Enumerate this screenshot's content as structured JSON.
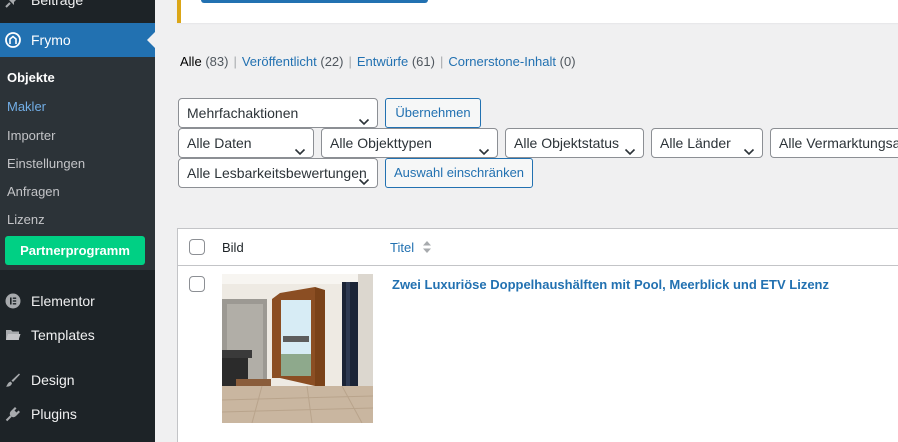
{
  "sidebar": {
    "prev_item_label": "Beiträge",
    "active_menu": {
      "label": "Frymo",
      "icon": "frymo-logo-icon"
    },
    "submenu": [
      {
        "label": "Objekte",
        "state": "current"
      },
      {
        "label": "Makler",
        "state": "hover"
      },
      {
        "label": "Importer",
        "state": ""
      },
      {
        "label": "Einstellungen",
        "state": ""
      },
      {
        "label": "Anfragen",
        "state": ""
      },
      {
        "label": "Lizenz",
        "state": ""
      }
    ],
    "partner_button": "Partnerprogramm",
    "menu": [
      {
        "label": "Elementor",
        "icon": "elementor-icon"
      },
      {
        "label": "Templates",
        "icon": "folder-icon"
      },
      {
        "label": "Design",
        "icon": "paintbrush-icon"
      },
      {
        "label": "Plugins",
        "icon": "plugin-icon"
      }
    ]
  },
  "views": {
    "all": {
      "label": "Alle",
      "count": "(83)"
    },
    "published": {
      "label": "Veröffentlicht",
      "count": "(22)"
    },
    "drafts": {
      "label": "Entwürfe",
      "count": "(61)"
    },
    "cornerstone": {
      "label": "Cornerstone-Inhalt",
      "count": "(0)"
    }
  },
  "bulk": {
    "selected": "Mehrfachaktionen",
    "apply_label": "Übernehmen"
  },
  "filters": {
    "dates": "Alle Daten",
    "types": "Alle Objekttypen",
    "status": "Alle Objektstatus",
    "countries": "Alle Länder",
    "marketing": "Alle Vermarktungsarten",
    "readability": "Alle Lesbarkeitsbewertungen",
    "filter_label": "Auswahl einschränken"
  },
  "table": {
    "columns": {
      "image": "Bild",
      "title": "Titel"
    },
    "rows": [
      {
        "title": "Zwei Luxuriöse Doppelhaushälften mit Pool, Meerblick und ETV Lizenz"
      }
    ]
  },
  "colors": {
    "accent": "#2271b1",
    "sidebar": "#1d2327",
    "partner": "#00d084",
    "notice": "#dba617"
  }
}
